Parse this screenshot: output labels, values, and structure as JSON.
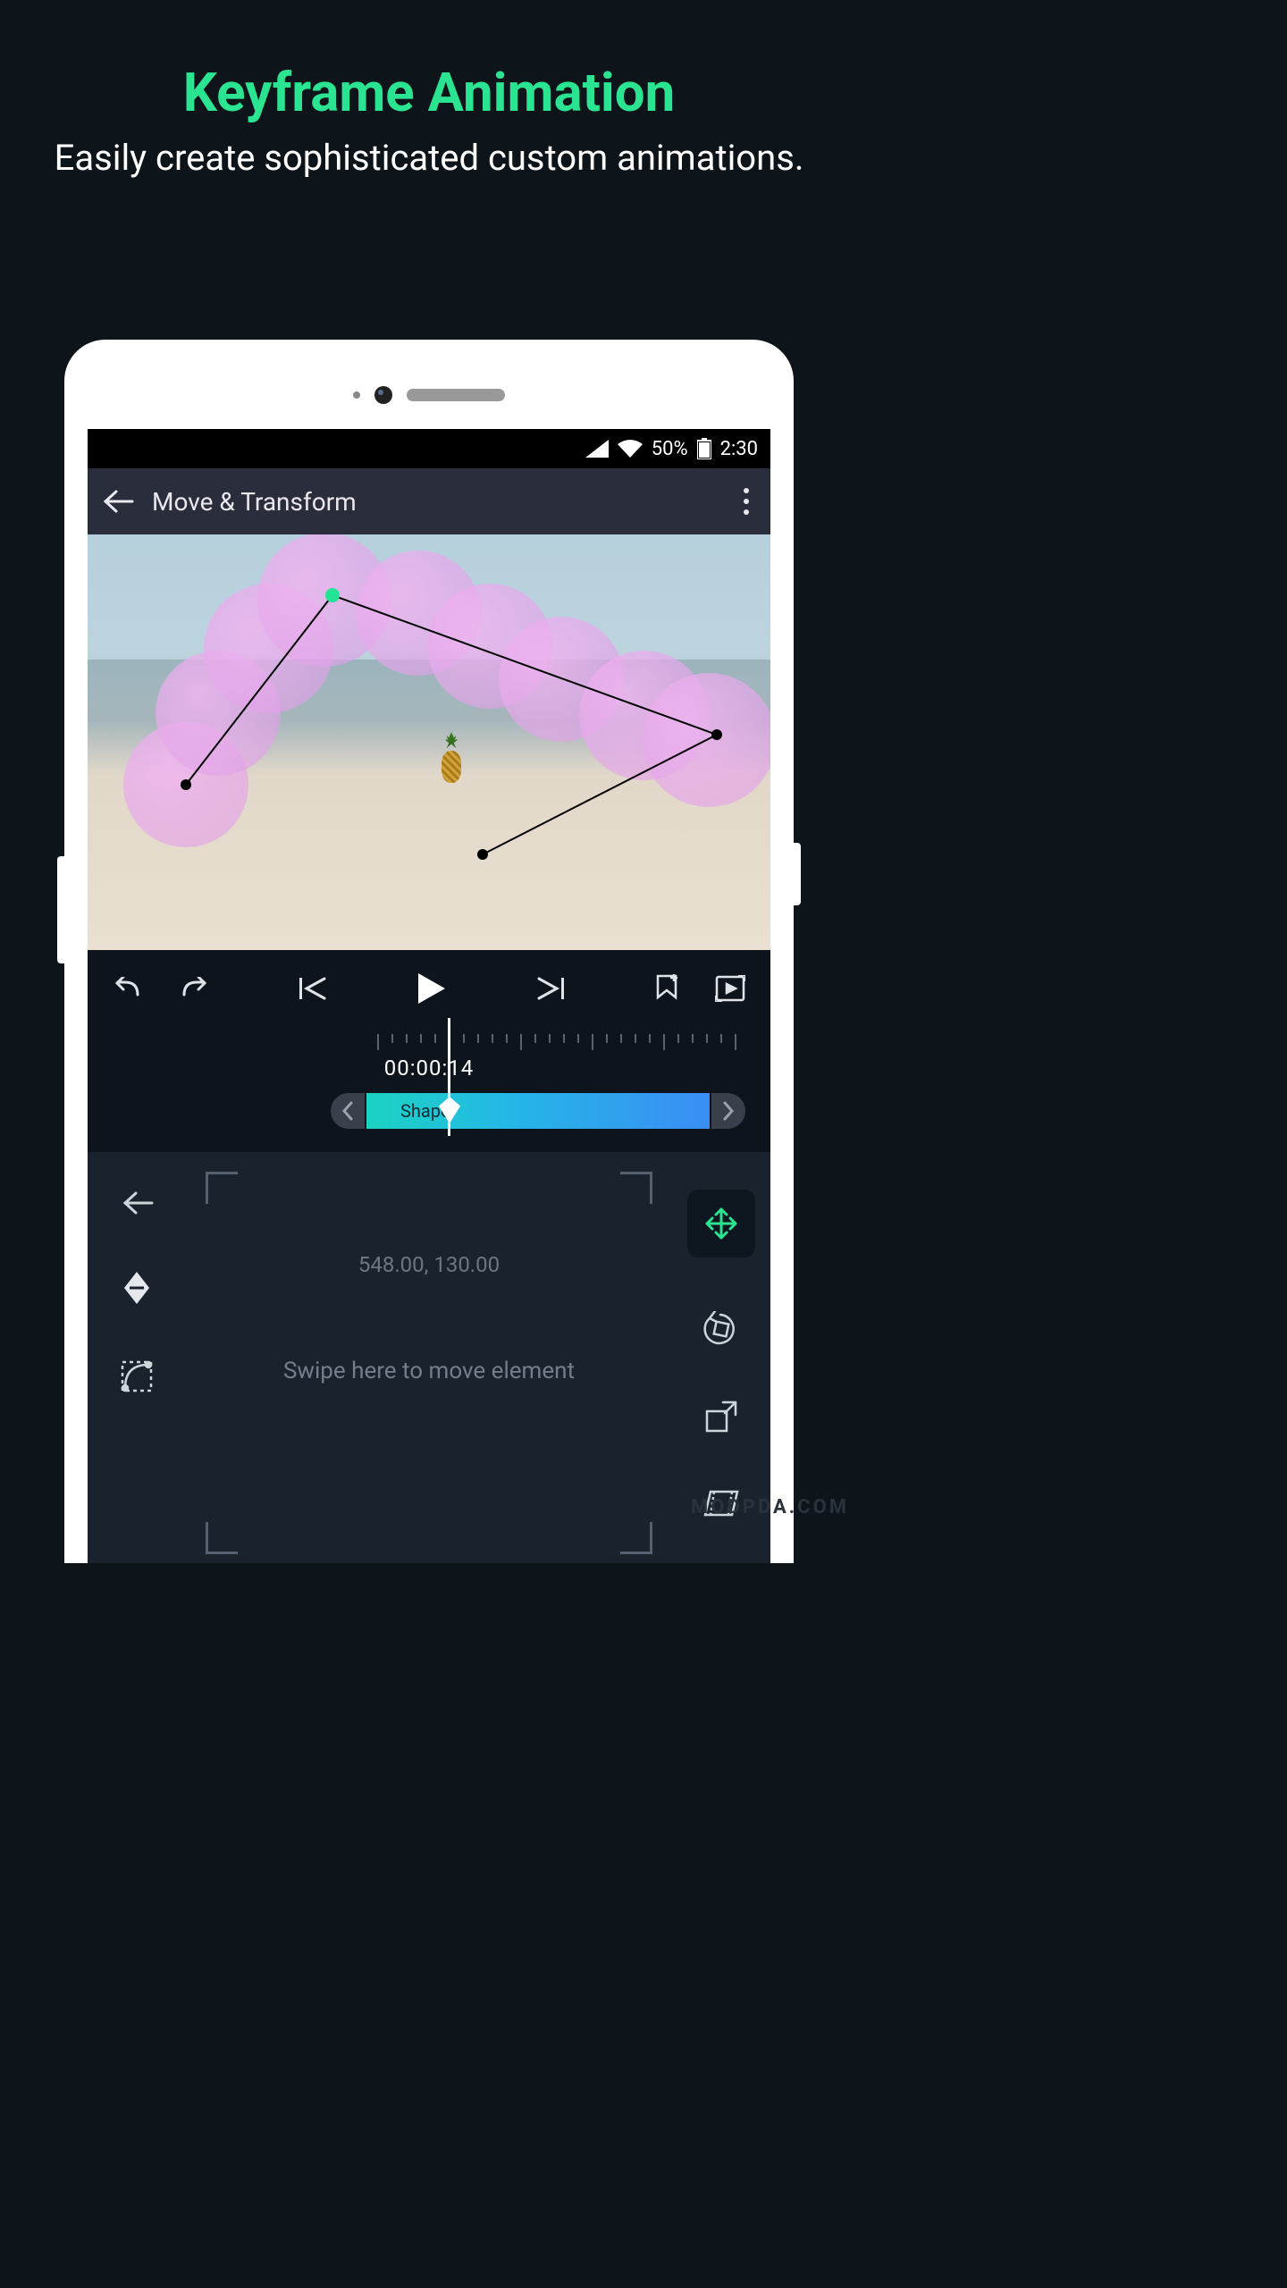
{
  "hero": {
    "title": "Keyframe Animation",
    "subtitle": "Easily create sophisticated custom animations."
  },
  "status": {
    "battery_pct": "50%",
    "time": "2:30"
  },
  "appbar": {
    "title": "Move & Transform"
  },
  "timeline": {
    "timecode": "00:00:14",
    "clip_label": "Shape"
  },
  "editor": {
    "coords": "548.00, 130.00",
    "swipe_hint": "Swipe here to move element"
  },
  "watermark": "MODPDA.COM",
  "icons": {
    "back": "back-arrow",
    "more": "more-vertical",
    "undo": "undo",
    "redo": "redo",
    "prev_key": "skip-start",
    "play": "play",
    "next_key": "skip-end",
    "add_key": "bookmark-add",
    "loop": "loop",
    "chev_left": "chevron-left",
    "chev_right": "chevron-right",
    "close_panel": "arrow-left",
    "keyframe_tool": "keyframe-diamond",
    "ease_curve": "ease-curve",
    "move_tool": "move-arrows",
    "rotate_tool": "rotate",
    "scale_tool": "scale",
    "skew_tool": "skew"
  },
  "colors": {
    "accent": "#2be491",
    "clip_grad_start": "#1bd3c2",
    "clip_grad_end": "#3a8df4",
    "motion_path": "#e8a8e8"
  }
}
